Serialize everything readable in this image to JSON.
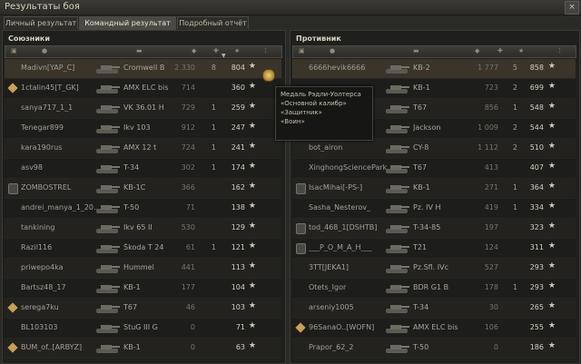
{
  "window": {
    "title": "Результаты боя",
    "close_glyph": "×"
  },
  "tabs": [
    {
      "label": "Личный результат"
    },
    {
      "label": "Командный результат",
      "active": true
    },
    {
      "label": "Подробный отчёт"
    }
  ],
  "tooltip": {
    "lines": [
      "Медаль Рэдли-Уолтерса",
      "«Основной калибр»",
      "«Защитник»",
      "«Воин»"
    ]
  },
  "allies": {
    "title": "Союзники",
    "rows": [
      {
        "name": "Madivn[YAP_C]",
        "tank": "Cromwell B",
        "damage": "2 330",
        "kills": "8",
        "xp": "804",
        "icon": "none",
        "me": true
      },
      {
        "name": "1ctalin45[T_GK]",
        "tank": "AMX ELC bis",
        "damage": "714",
        "kills": "",
        "xp": "360",
        "icon": "diamond"
      },
      {
        "name": "sanya717_1_1",
        "tank": "VK 36.01 H",
        "damage": "729",
        "kills": "1",
        "xp": "259",
        "icon": "none"
      },
      {
        "name": "Tenegar899",
        "tank": "Ikv 103",
        "damage": "912",
        "kills": "1",
        "xp": "247",
        "icon": "none"
      },
      {
        "name": "kara190rus",
        "tank": "AMX 12 t",
        "damage": "724",
        "kills": "1",
        "xp": "241",
        "icon": "none"
      },
      {
        "name": "asv98",
        "tank": "T-34",
        "damage": "302",
        "kills": "1",
        "xp": "174",
        "icon": "none"
      },
      {
        "name": "ZOMBOSTREL",
        "tank": "KB-1C",
        "damage": "366",
        "kills": "",
        "xp": "162",
        "icon": "platoon"
      },
      {
        "name": "andrei_manya_1_20..",
        "tank": "T-50",
        "damage": "71",
        "kills": "",
        "xp": "138",
        "icon": "none"
      },
      {
        "name": "tankining",
        "tank": "Ikv 65 II",
        "damage": "530",
        "kills": "",
        "xp": "129",
        "icon": "none"
      },
      {
        "name": "Razil116",
        "tank": "Škoda T 24",
        "damage": "61",
        "kills": "1",
        "xp": "121",
        "icon": "none"
      },
      {
        "name": "priwepo4ka",
        "tank": "Hummel",
        "damage": "441",
        "kills": "",
        "xp": "113",
        "icon": "none"
      },
      {
        "name": "Bartsz48_17",
        "tank": "KB-1",
        "damage": "177",
        "kills": "",
        "xp": "104",
        "icon": "none"
      },
      {
        "name": "serega7ku",
        "tank": "T67",
        "damage": "46",
        "kills": "",
        "xp": "103",
        "icon": "diamond"
      },
      {
        "name": "BL103103",
        "tank": "StuG III G",
        "damage": "0",
        "kills": "",
        "xp": "71",
        "icon": "none"
      },
      {
        "name": "BUM_of..[ARBYZ]",
        "tank": "KB-1",
        "damage": "0",
        "kills": "",
        "xp": "63",
        "icon": "diamond"
      }
    ]
  },
  "enemies": {
    "title": "Противник",
    "rows": [
      {
        "name": "6666hevik6666",
        "tank": "KB-2",
        "damage": "1 777",
        "kills": "5",
        "xp": "858",
        "icon": "none",
        "me": true
      },
      {
        "name": "",
        "tank": "KB-1",
        "damage": "723",
        "kills": "2",
        "xp": "699",
        "icon": "none"
      },
      {
        "name": "",
        "tank": "T67",
        "damage": "856",
        "kills": "1",
        "xp": "548",
        "icon": "none"
      },
      {
        "name": "",
        "tank": "Jackson",
        "damage": "1 009",
        "kills": "2",
        "xp": "544",
        "icon": "none"
      },
      {
        "name": "bot_airon",
        "tank": "CY-8",
        "damage": "1 112",
        "kills": "2",
        "xp": "510",
        "icon": "none"
      },
      {
        "name": "XinghongSciencePark",
        "tank": "T67",
        "damage": "413",
        "kills": "",
        "xp": "407",
        "icon": "none"
      },
      {
        "name": "IsacMihai[-PS-]",
        "tank": "KB-1",
        "damage": "271",
        "kills": "1",
        "xp": "364",
        "icon": "platoon"
      },
      {
        "name": "Sasha_Nesterov_",
        "tank": "Pz. IV H",
        "damage": "419",
        "kills": "1",
        "xp": "334",
        "icon": "none"
      },
      {
        "name": "tod_468_1[DSHTB]",
        "tank": "T-34-85",
        "damage": "197",
        "kills": "",
        "xp": "323",
        "icon": "platoon"
      },
      {
        "name": "___P_O_M_A_H___",
        "tank": "T21",
        "damage": "124",
        "kills": "",
        "xp": "311",
        "icon": "platoon"
      },
      {
        "name": "3TT[JEKA1]",
        "tank": "Pz.Sfl. IVc",
        "damage": "527",
        "kills": "",
        "xp": "293",
        "icon": "none"
      },
      {
        "name": "Otets_Igor",
        "tank": "BDR G1 B",
        "damage": "178",
        "kills": "1",
        "xp": "293",
        "icon": "none"
      },
      {
        "name": "arseniy1005",
        "tank": "T-34",
        "damage": "30",
        "kills": "",
        "xp": "265",
        "icon": "none"
      },
      {
        "name": "96SanaO..[WOFN]",
        "tank": "AMX ELC bis",
        "damage": "106",
        "kills": "",
        "xp": "255",
        "icon": "diamond"
      },
      {
        "name": "Prapor_62_2",
        "tank": "T-50",
        "damage": "0",
        "kills": "",
        "xp": "186",
        "icon": "none"
      }
    ]
  },
  "colors": {
    "accent": "#c9a050",
    "highlight_row": "#3a342b",
    "text": "#a29f95"
  }
}
